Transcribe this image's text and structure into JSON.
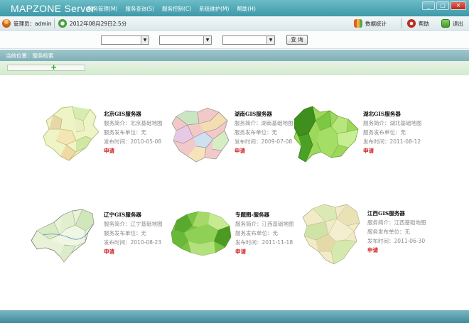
{
  "app": {
    "title": "MAPZONE Server",
    "menu": [
      "服务管理(M)",
      "服务查询(S)",
      "服务控制(C)",
      "系统维护(M)",
      "帮助(H)"
    ],
    "window_buttons": [
      "_",
      "□",
      "×"
    ]
  },
  "toolbar": {
    "user_label": "管理员：admin",
    "datetime": "2012年08月29日2:5分",
    "stats_label": "数据统计",
    "help_label": "帮助",
    "exit_label": "退出"
  },
  "filter": {
    "query_label": "查 询"
  },
  "breadcrumb": "当前位置：服务检索",
  "colors": {
    "titlebar": "#3e99a8",
    "apply": "#d02020"
  },
  "cards": [
    {
      "title": "北京GIS服务器",
      "desc": "服务简介：北京基础地图",
      "unit": "服务发布单位：无",
      "date": "发布时间：2010-05-08",
      "apply": "申请"
    },
    {
      "title": "湖南GIS服务器",
      "desc": "服务简介：湖南基础地图",
      "unit": "服务发布单位：无",
      "date": "发布时间：2009-07-08",
      "apply": "申请"
    },
    {
      "title": "湖北GIS服务器",
      "desc": "服务简介：湖北基础地图",
      "unit": "服务发布单位：无",
      "date": "发布时间：2011-08-12",
      "apply": "申请"
    },
    {
      "title": "辽宁GIS服务器",
      "desc": "服务简介：辽宁基础地图",
      "unit": "服务发布单位：无",
      "date": "发布时间：2010-08-23",
      "apply": "申请"
    },
    {
      "title": "专题图-服务器",
      "desc": "服务简介：江西基础地图",
      "unit": "服务发布单位：无",
      "date": "发布时间：2011-11-18",
      "apply": "申请"
    },
    {
      "title": "江西GIS服务器",
      "desc": "服务简介：江西基础地图",
      "unit": "服务发布单位：无",
      "date": "发布时间：2011-06-30",
      "apply": "申请"
    }
  ]
}
